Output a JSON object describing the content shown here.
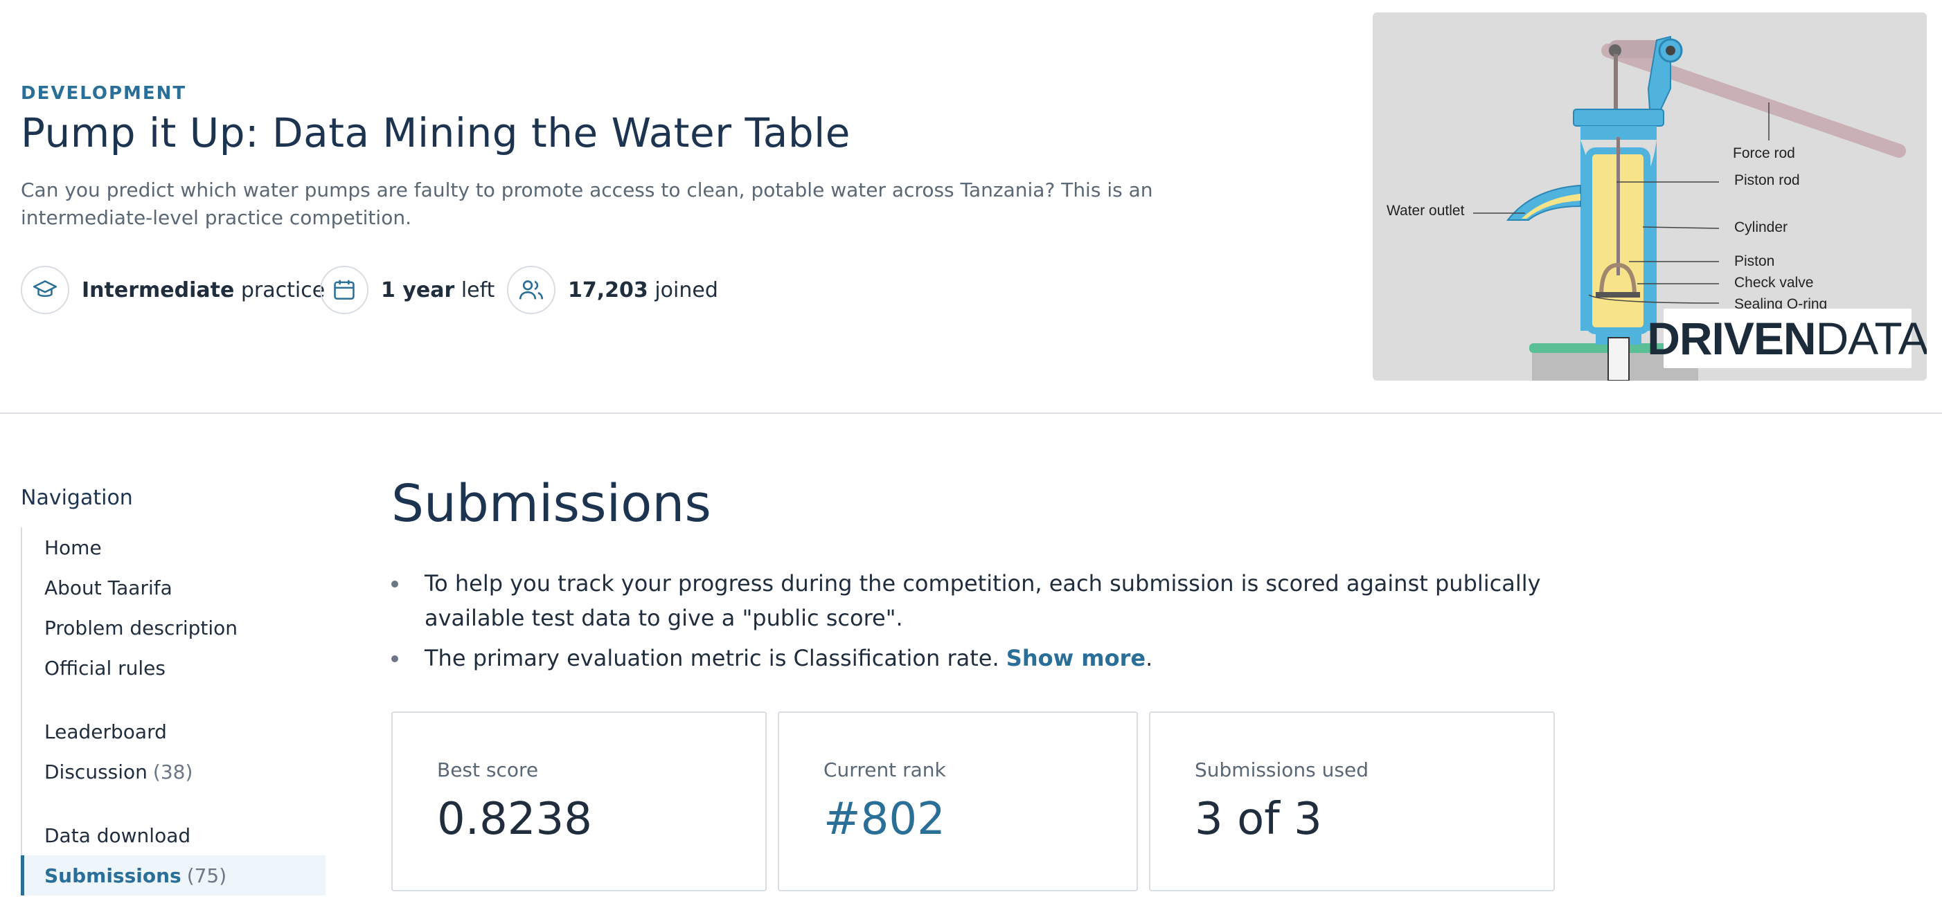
{
  "header": {
    "category": "DEVELOPMENT",
    "title": "Pump it Up: Data Mining the Water Table",
    "description": "Can you predict which water pumps are faulty to promote access to clean, potable water across Tanzania? This is an intermediate-level practice competition.",
    "stats": [
      {
        "icon": "graduation-cap-icon",
        "bold": "Intermediate",
        "rest": "practice"
      },
      {
        "icon": "calendar-icon",
        "bold": "1 year",
        "rest": "left"
      },
      {
        "icon": "users-icon",
        "bold": "17,203",
        "rest": "joined"
      }
    ]
  },
  "banner": {
    "labels": {
      "force_rod": "Force rod",
      "piston_rod": "Piston rod",
      "water_outlet": "Water outlet",
      "cylinder": "Cylinder",
      "piston": "Piston",
      "check_valve": "Check valve",
      "sealing_o_ring": "Sealing O-ring"
    },
    "brand_primary": "DRIVEN",
    "brand_secondary": "DATA"
  },
  "nav": {
    "title": "Navigation",
    "items": [
      {
        "label": "Home",
        "count": ""
      },
      {
        "label": "About Taarifa",
        "count": ""
      },
      {
        "label": "Problem description",
        "count": ""
      },
      {
        "label": "Official rules",
        "count": ""
      },
      {
        "label": "Leaderboard",
        "count": ""
      },
      {
        "label": "Discussion",
        "count": "(38)"
      },
      {
        "label": "Data download",
        "count": ""
      },
      {
        "label": "Submissions",
        "count": "(75)"
      }
    ]
  },
  "main": {
    "title": "Submissions",
    "bullet1": "To help you track your progress during the competition, each submission is scored against publically available test data to give a \"public score\".",
    "bullet2_prefix": "The primary evaluation metric is Classification rate.",
    "bullet2_link": "Show more",
    "bullet2_suffix": "."
  },
  "cards": {
    "best_score_label": "Best score",
    "best_score_value": "0.8238",
    "current_rank_label": "Current rank",
    "current_rank_value": "#802",
    "submissions_used_label": "Submissions used",
    "submissions_used_value": "3 of 3"
  },
  "colors": {
    "accent": "#2a6f97",
    "heading": "#1c3450",
    "muted": "#5a6774"
  }
}
